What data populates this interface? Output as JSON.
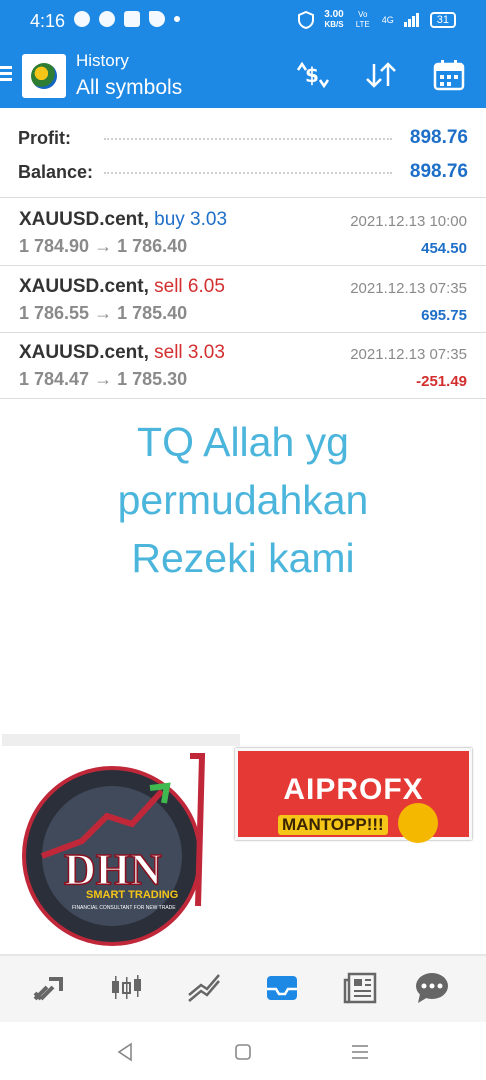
{
  "status_bar": {
    "time": "4:16",
    "speed_value": "3.00",
    "speed_unit": "KB/S",
    "network": "4G",
    "volte": "Vo LTE",
    "battery": "31"
  },
  "app_bar": {
    "title": "History",
    "subtitle": "All symbols",
    "actions": [
      "currency-swap-icon",
      "sort-icon",
      "calendar-icon"
    ]
  },
  "summary": {
    "profit_label": "Profit:",
    "profit_value": "898.76",
    "balance_label": "Balance:",
    "balance_value": "898.76"
  },
  "deals": [
    {
      "symbol": "XAUUSD.cent,",
      "side": "buy 3.03",
      "prices": "1 784.90 → 1 786.40",
      "time": "2021.12.13 10:00",
      "profit": "454.50"
    },
    {
      "symbol": "XAUUSD.cent,",
      "side": "sell 6.05",
      "prices": "1 786.55 → 1 785.40",
      "time": "2021.12.13 07:35",
      "profit": "695.75"
    },
    {
      "symbol": "XAUUSD.cent,",
      "side": "sell 3.03",
      "prices": "1 784.47 → 1 785.30",
      "time": "2021.12.13 07:35",
      "profit": "-251.49"
    }
  ],
  "caption": {
    "line1": "TQ Allah yg",
    "line2": "permudahkan",
    "line3": "Rezeki kami"
  },
  "logos": {
    "dhn": "DHN",
    "dhn_sub": "SMART TRADING",
    "dhn_tag": "FINANCIAL CONSULTANT FOR NEW TRADE",
    "aiprofx": "AIPROFX",
    "aiprofx_tag": "MANTOPP!!!"
  },
  "bottom_nav": [
    "quotes-icon",
    "chart-icon",
    "trade-icon",
    "history-icon",
    "news-icon",
    "chat-icon"
  ],
  "colors": {
    "primary": "#1e88e5",
    "profit_blue": "#1e6fc8",
    "loss_red": "#d32f2f",
    "caption": "#4bb5dc"
  }
}
